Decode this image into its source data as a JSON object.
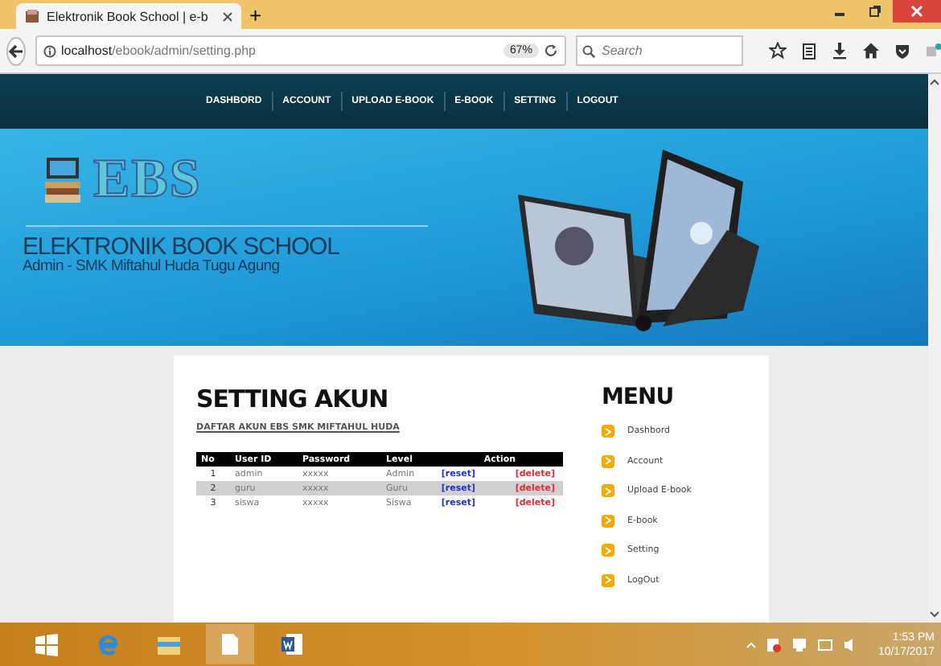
{
  "browser": {
    "tab_title": "Elektronik Book School | e-b",
    "new_tab": "+",
    "url_host": "localhost",
    "url_path": "/ebook/admin/setting.php",
    "zoom": "67%",
    "search_placeholder": "Search"
  },
  "nav": [
    {
      "label": "DASHBORD"
    },
    {
      "label": "ACCOUNT"
    },
    {
      "label": "UPLOAD E-BOOK"
    },
    {
      "label": "E-BOOK"
    },
    {
      "label": "SETTING"
    },
    {
      "label": "LOGOUT"
    }
  ],
  "banner": {
    "logo": "EBS",
    "title": "ELEKTRONIK BOOK SCHOOL",
    "subtitle": "Admin - SMK Miftahul Huda Tugu Agung"
  },
  "content": {
    "heading": "SETTING AKUN",
    "subheading": "DAFTAR AKUN EBS SMK MIFTAHUL HUDA",
    "table": {
      "columns": [
        "No",
        "User ID",
        "Password",
        "Level",
        "Action"
      ],
      "rows": [
        {
          "cells": [
            "1",
            "admin",
            "xxxxx",
            "Admin"
          ],
          "actions": [
            "[reset]",
            "[delete]"
          ],
          "highlighted": false
        },
        {
          "cells": [
            "2",
            "guru",
            "xxxxx",
            "Guru"
          ],
          "actions": [
            "[reset]",
            "[delete]"
          ],
          "highlighted": true
        },
        {
          "cells": [
            "3",
            "siswa",
            "xxxxx",
            "Siswa"
          ],
          "actions": [
            "[reset]",
            "[delete]"
          ],
          "highlighted": false
        }
      ]
    }
  },
  "menu": {
    "title": "MENU",
    "items": [
      "Dashbord",
      "Account",
      "Upload E-book",
      "E-book",
      "Setting",
      "LogOut"
    ]
  },
  "taskbar": {
    "time": "1:53 PM",
    "date": "10/17/2017"
  }
}
